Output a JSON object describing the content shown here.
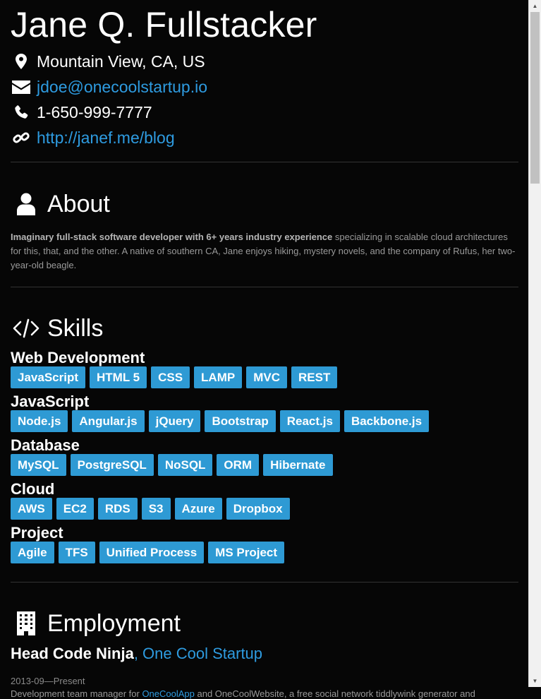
{
  "profile": {
    "name": "Jane Q. Fullstacker",
    "location": "Mountain View, CA, US",
    "email": "jdoe@onecoolstartup.io",
    "phone": "1-650-999-7777",
    "website": "http://janef.me/blog"
  },
  "about": {
    "heading": "About",
    "summary_bold": "Imaginary full-stack software developer with 6+ years industry experience",
    "summary_rest": " specializing in scalable cloud architectures for this, that, and the other. A native of southern CA, Jane enjoys hiking, mystery novels, and the company of Rufus, her two-year-old beagle."
  },
  "skills": {
    "heading": "Skills",
    "categories": [
      {
        "name": "Web Development",
        "items": [
          "JavaScript",
          "HTML 5",
          "CSS",
          "LAMP",
          "MVC",
          "REST"
        ]
      },
      {
        "name": "JavaScript",
        "items": [
          "Node.js",
          "Angular.js",
          "jQuery",
          "Bootstrap",
          "React.js",
          "Backbone.js"
        ]
      },
      {
        "name": "Database",
        "items": [
          "MySQL",
          "PostgreSQL",
          "NoSQL",
          "ORM",
          "Hibernate"
        ]
      },
      {
        "name": "Cloud",
        "items": [
          "AWS",
          "EC2",
          "RDS",
          "S3",
          "Azure",
          "Dropbox"
        ]
      },
      {
        "name": "Project",
        "items": [
          "Agile",
          "TFS",
          "Unified Process",
          "MS Project"
        ]
      }
    ]
  },
  "employment": {
    "heading": "Employment",
    "jobs": [
      {
        "title": "Head Code Ninja",
        "separator": ", ",
        "company": "One Cool Startup",
        "dates": "2013-09—Present",
        "desc_pre": "Development team manager for ",
        "desc_link": "OneCoolApp",
        "desc_post": " and OneCoolWebsite, a free social network tiddlywink generator and"
      }
    ]
  },
  "icons": {
    "location": "map-marker-icon",
    "email": "envelope-icon",
    "phone": "phone-icon",
    "website": "link-icon",
    "about": "user-icon",
    "skills": "code-icon",
    "employment": "building-icon"
  },
  "colors": {
    "background": "#060606",
    "link": "#2e9be0",
    "tag": "#2e9ad4",
    "muted_text": "#9a9a9a"
  }
}
